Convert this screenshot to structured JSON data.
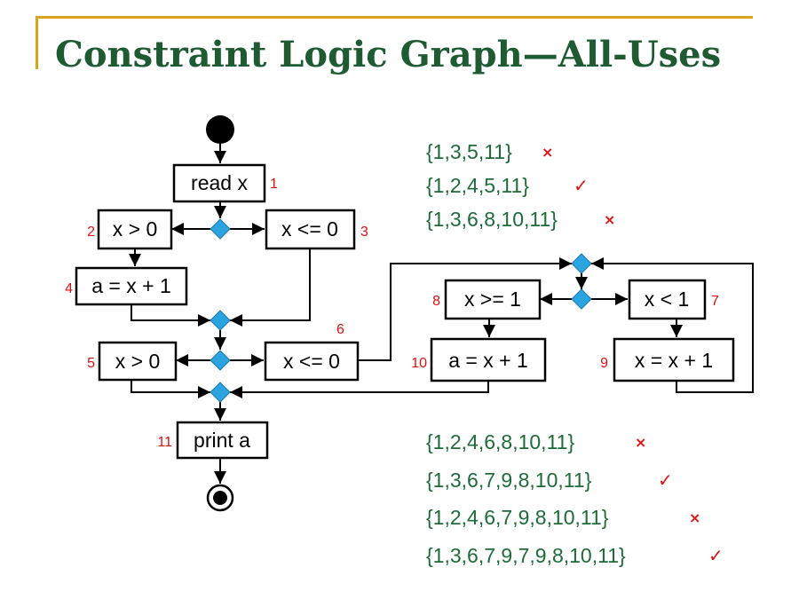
{
  "title": "Constraint Logic Graph—All-Uses",
  "colors": {
    "accent": "#d9a21c",
    "title": "#1e5a32",
    "path": "#1e6b3a",
    "mark": "#e01010",
    "decision": "#2aa4e0"
  },
  "nodes": {
    "n1": {
      "label": "read x",
      "num": "1"
    },
    "n2": {
      "label": "x > 0",
      "num": "2"
    },
    "n3": {
      "label": "x <= 0",
      "num": "3"
    },
    "n4": {
      "label": "a = x + 1",
      "num": "4"
    },
    "n5": {
      "label": "x > 0",
      "num": "5"
    },
    "n6": {
      "label": "x <= 0",
      "num": "6"
    },
    "n7": {
      "label": "x < 1",
      "num": "7"
    },
    "n8": {
      "label": "x >= 1",
      "num": "8"
    },
    "n9": {
      "label": "x = x + 1",
      "num": "9"
    },
    "n10": {
      "label": "a = x + 1",
      "num": "10"
    },
    "n11": {
      "label": "print a",
      "num": "11"
    }
  },
  "paths_top": [
    {
      "text": "{1,3,5,11}",
      "mark": "×",
      "valid": false
    },
    {
      "text": "{1,2,4,5,11}",
      "mark": "✓",
      "valid": true
    },
    {
      "text": "{1,3,6,8,10,11}",
      "mark": "×",
      "valid": false
    }
  ],
  "paths_bottom": [
    {
      "text": "{1,2,4,6,8,10,11}",
      "mark": "×",
      "valid": false
    },
    {
      "text": "{1,3,6,7,9,8,10,11}",
      "mark": "✓",
      "valid": true
    },
    {
      "text": "{1,2,4,6,7,9,8,10,11}",
      "mark": "×",
      "valid": false
    },
    {
      "text": "{1,3,6,7,9,7,9,8,10,11}",
      "mark": "✓",
      "valid": true
    }
  ]
}
